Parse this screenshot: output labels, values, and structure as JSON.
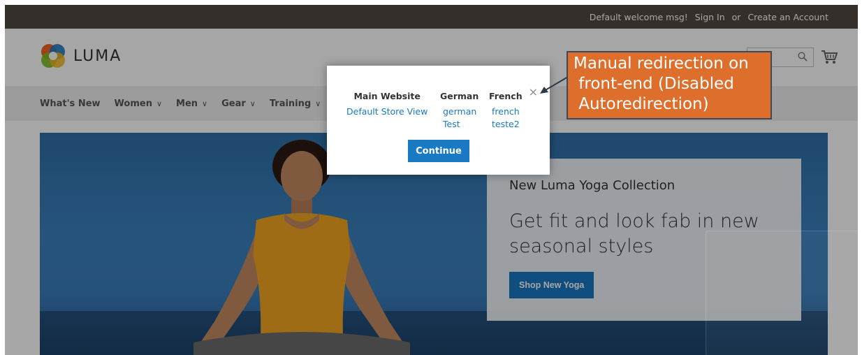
{
  "topbar": {
    "welcome": "Default welcome msg!",
    "sign_in": "Sign In",
    "or": "or",
    "create_account": "Create an Account"
  },
  "logo": {
    "text": "LUMA"
  },
  "nav": {
    "items": [
      {
        "label": "What's New",
        "dropdown": false
      },
      {
        "label": "Women",
        "dropdown": true
      },
      {
        "label": "Men",
        "dropdown": true
      },
      {
        "label": "Gear",
        "dropdown": true
      },
      {
        "label": "Training",
        "dropdown": true
      }
    ],
    "chevron": "∨"
  },
  "hero": {
    "subtitle": "New Luma Yoga Collection",
    "headline": "Get fit and look fab in new seasonal styles",
    "button": "Shop New Yoga"
  },
  "modal": {
    "close": "×",
    "columns": [
      {
        "heading": "Main Website",
        "links": [
          "Default Store View"
        ]
      },
      {
        "heading": "German",
        "links": [
          "german",
          "Test"
        ]
      },
      {
        "heading": "French",
        "links": [
          "french",
          "teste2"
        ]
      }
    ],
    "continue": "Continue"
  },
  "annotation": {
    "lines": [
      "Manual redirection on",
      " front-end (Disabled",
      " Autoredirection)"
    ]
  },
  "icons": {
    "search": "search-icon",
    "cart": "cart-icon",
    "close": "close-icon"
  },
  "colors": {
    "topbar": "#514943",
    "link": "#1979c3",
    "annotation": "#dd6e2b"
  }
}
